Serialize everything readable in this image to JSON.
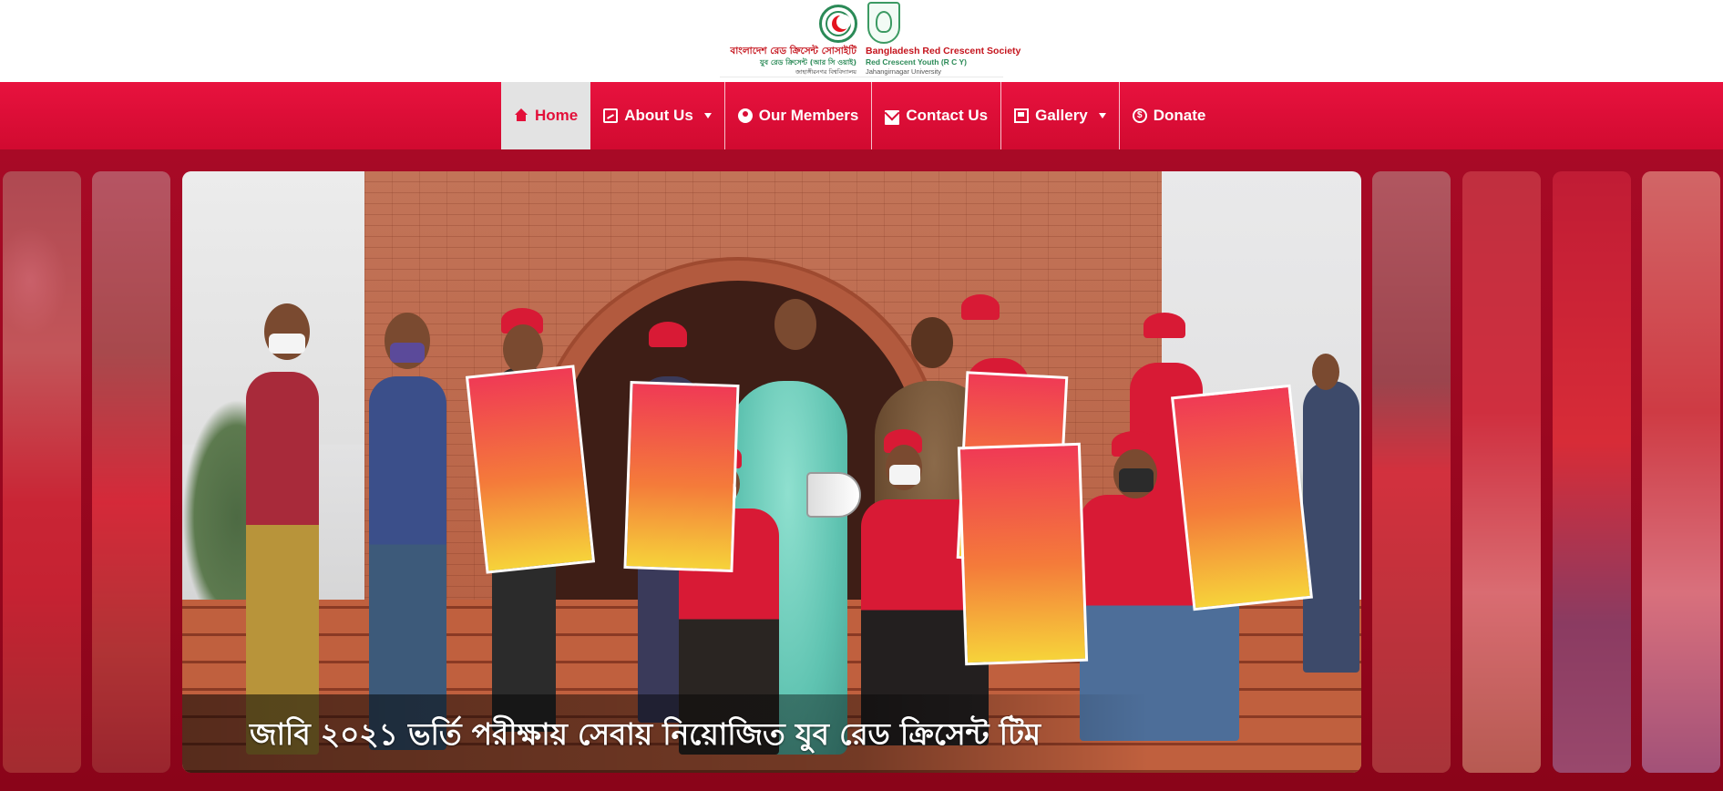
{
  "site": {
    "logo_bn_line1": "বাংলাদেশ রেড ক্রিসেন্ট সোসাইটি",
    "logo_bn_line2": "যুব রেড ক্রিসেন্ট (আর সি ওয়াই)",
    "logo_bn_line3": "জাহাঙ্গীরনগর বিশ্ববিদ্যালয়",
    "logo_en_line1": "Bangladesh Red Crescent Society",
    "logo_en_line2": "Red Crescent Youth (R C Y)",
    "logo_en_line3": "Jahangirnagar University"
  },
  "nav": {
    "items": [
      {
        "label": "Home",
        "icon": "home-icon",
        "active": true,
        "dropdown": false
      },
      {
        "label": "About Us",
        "icon": "id-card-icon",
        "active": false,
        "dropdown": true
      },
      {
        "label": "Our Members",
        "icon": "user-circle-icon",
        "active": false,
        "dropdown": false
      },
      {
        "label": "Contact Us",
        "icon": "envelope-icon",
        "active": false,
        "dropdown": false
      },
      {
        "label": "Gallery",
        "icon": "images-icon",
        "active": false,
        "dropdown": true
      },
      {
        "label": "Donate",
        "icon": "dollar-circle-icon",
        "active": false,
        "dropdown": false
      }
    ]
  },
  "slider": {
    "caption": "জাবি ২০২১ ভর্তি পরীক্ষায় সেবায় নিয়োজিত যুব রেড ক্রিসেন্ট টিম",
    "slide_count_left": 2,
    "slide_count_right": 4
  },
  "colors": {
    "brand_red": "#e3103a",
    "brand_green": "#2b8a57",
    "slider_bg": "#9a0720",
    "nav_active_bg": "#e3e3e3"
  }
}
